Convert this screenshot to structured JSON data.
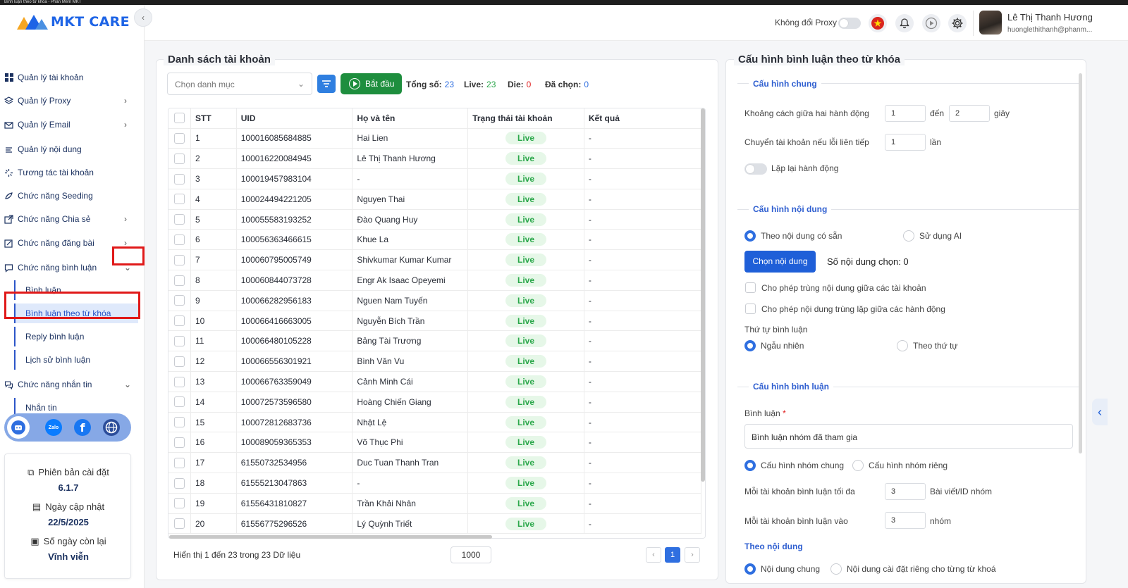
{
  "window": {
    "title": "Bình luận theo từ khóa - Phần Mềm MKT"
  },
  "app": {
    "logo_text": "MKT CARE",
    "brand_color": "#1e64e6"
  },
  "sidebar": {
    "items": [
      {
        "label": "Quản lý tài khoản",
        "icon": "grid-icon",
        "has_chevron": false
      },
      {
        "label": "Quản lý Proxy",
        "icon": "layers-icon",
        "has_chevron": true
      },
      {
        "label": "Quản lý Email",
        "icon": "mail-icon",
        "has_chevron": true
      },
      {
        "label": "Quản lý nội dung",
        "icon": "content-icon",
        "has_chevron": false
      },
      {
        "label": "Tương tác tài khoản",
        "icon": "interact-icon",
        "has_chevron": false
      },
      {
        "label": "Chức năng Seeding",
        "icon": "seeding-icon",
        "has_chevron": false
      },
      {
        "label": "Chức năng Chia sẻ",
        "icon": "share-icon",
        "has_chevron": true
      },
      {
        "label": "Chức năng đăng bài",
        "icon": "post-icon",
        "has_chevron": true
      },
      {
        "label": "Chức năng bình luận",
        "icon": "comment-icon",
        "has_chevron": true
      },
      {
        "label": "Chức năng nhắn tin",
        "icon": "chat-icon",
        "has_chevron": true
      }
    ],
    "comment_sub": [
      "Bình luận",
      "Bình luận theo từ khóa",
      "Reply bình luận",
      "Lịch sử bình luận"
    ],
    "message_sub": [
      "Nhắn tin"
    ],
    "social": [
      "support-icon",
      "zalo-icon",
      "facebook-icon",
      "globe-icon"
    ],
    "zalo_label": "Zalo",
    "info": {
      "version_label": "Phiên bản cài đặt",
      "version": "6.1.7",
      "update_label": "Ngày cập nhật",
      "update_date": "22/5/2025",
      "days_label": "Số ngày còn lại",
      "days": "Vĩnh viễn"
    }
  },
  "topbar": {
    "proxy_label": "Không đổi Proxy",
    "user_name": "Lê Thị Thanh Hương",
    "user_email": "huonglethithanh@phanm..."
  },
  "accounts": {
    "title": "Danh sách tài khoản",
    "category_placeholder": "Chọn danh mục",
    "start_label": "Bắt đầu",
    "stats": [
      {
        "label": "Tổng số:",
        "value": "23",
        "color": "#2f6fe0"
      },
      {
        "label": "Live:",
        "value": "23",
        "color": "#2aa74a"
      },
      {
        "label": "Die:",
        "value": "0",
        "color": "#e02020"
      },
      {
        "label": "Đã chọn:",
        "value": "0",
        "color": "#2f6fe0"
      }
    ],
    "columns": [
      "STT",
      "UID",
      "Họ và tên",
      "Trạng thái tài khoản",
      "Kết quả"
    ],
    "rows": [
      [
        "1",
        "100016085684885",
        "Hai Lien",
        "Live",
        "-"
      ],
      [
        "2",
        "100016220084945",
        "Lê Thị Thanh Hương",
        "Live",
        "-"
      ],
      [
        "3",
        "100019457983104",
        "-",
        "Live",
        "-"
      ],
      [
        "4",
        "100024494221205",
        "Nguyen Thai",
        "Live",
        "-"
      ],
      [
        "5",
        "100055583193252",
        "Đào Quang Huy",
        "Live",
        "-"
      ],
      [
        "6",
        "100056363466615",
        "Khue La",
        "Live",
        "-"
      ],
      [
        "7",
        "100060795005749",
        "Shivkumar Kumar Kumar",
        "Live",
        "-"
      ],
      [
        "8",
        "100060844073728",
        "Engr Ak Isaac Opeyemi",
        "Live",
        "-"
      ],
      [
        "9",
        "100066282956183",
        "Nguen Nam Tuyến",
        "Live",
        "-"
      ],
      [
        "10",
        "100066416663005",
        "Nguyễn Bích Trần",
        "Live",
        "-"
      ],
      [
        "11",
        "100066480105228",
        "Bảng Tài Trương",
        "Live",
        "-"
      ],
      [
        "12",
        "100066556301921",
        "Bình Văn Vu",
        "Live",
        "-"
      ],
      [
        "13",
        "100066763359049",
        "Cảnh Minh Cái",
        "Live",
        "-"
      ],
      [
        "14",
        "100072573596580",
        "Hoàng Chiến Giang",
        "Live",
        "-"
      ],
      [
        "15",
        "100072812683736",
        "Nhật Lệ",
        "Live",
        "-"
      ],
      [
        "16",
        "100089059365353",
        "Võ Thục Phi",
        "Live",
        "-"
      ],
      [
        "17",
        "61550732534956",
        "Duc Tuan Thanh Tran",
        "Live",
        "-"
      ],
      [
        "18",
        "61555213047863",
        "-",
        "Live",
        "-"
      ],
      [
        "19",
        "61556431810827",
        "Trần Khải Nhân",
        "Live",
        "-"
      ],
      [
        "20",
        "61556775296526",
        "Lý Quỳnh Triết",
        "Live",
        "-"
      ]
    ],
    "footer_text": "Hiển thị 1 đến 23 trong 23 Dữ liệu",
    "page_size": "1000",
    "prev": "‹",
    "page": "1",
    "next": "›"
  },
  "config": {
    "title": "Cấu hình bình luận theo từ khóa",
    "general": {
      "title": "Cấu hình chung",
      "interval_label": "Khoảng cách giữa hai hành động",
      "interval_from": "1",
      "interval_to_label": "đến",
      "interval_to": "2",
      "interval_unit": "giây",
      "switch_label": "Chuyển tài khoản nếu lỗi liên tiếp",
      "switch_value": "1",
      "switch_unit": "lần",
      "repeat_label": "Lặp lại hành động"
    },
    "content": {
      "title": "Cấu hình nội dung",
      "opt_available": "Theo nội dung có sẵn",
      "opt_ai": "Sử dụng AI",
      "choose_label": "Chọn nội dung",
      "count_label": "Số nội dung chọn: 0",
      "allow_dup_accounts": "Cho phép trùng nội dung giữa các tài khoản",
      "allow_dup_actions": "Cho phép nội dung trùng lặp giữa các hành động",
      "order_label": "Thứ tự bình luận",
      "order_random": "Ngẫu nhiên",
      "order_sequence": "Theo thứ tự"
    },
    "comment": {
      "title": "Cấu hình bình luận",
      "comment_label": "Bình luận",
      "required_mark": "*",
      "comment_value": "Bình luận nhóm đã tham gia",
      "group_common": "Cấu hình nhóm chung",
      "group_private": "Cấu hình nhóm riêng",
      "max_label": "Mỗi tài khoản bình luận tối đa",
      "max_value": "3",
      "max_unit": "Bài viết/ID nhóm",
      "into_label": "Mỗi tài khoản bình luận vào",
      "into_value": "3",
      "into_unit": "nhóm",
      "by_content_title": "Theo nội dung",
      "bc_common": "Nội dung chung",
      "bc_private": "Nội dung cài đặt riêng cho từng từ khoá"
    }
  }
}
